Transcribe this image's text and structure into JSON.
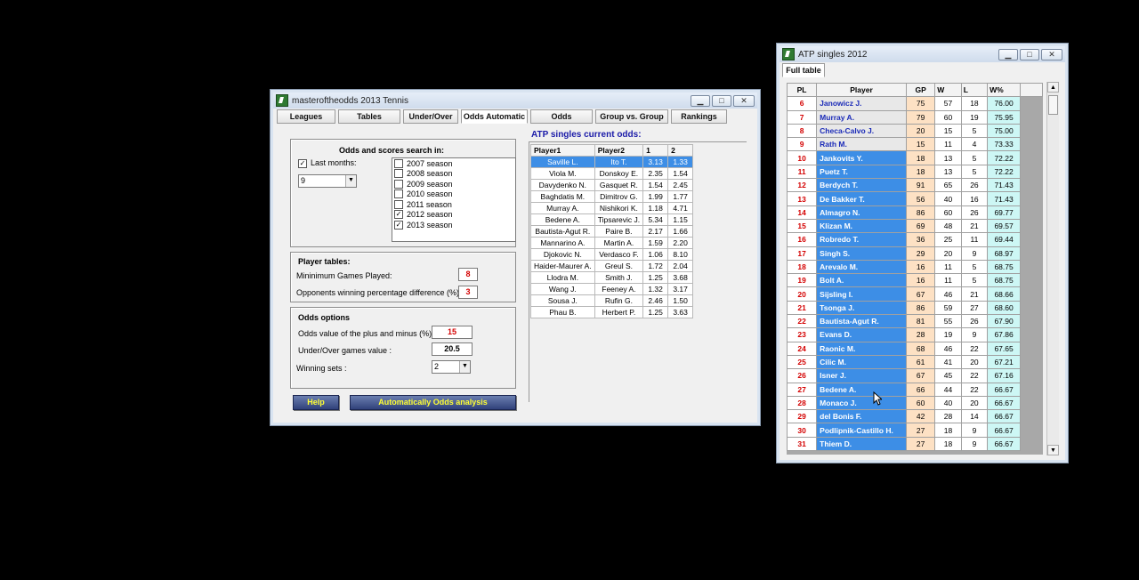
{
  "main_window": {
    "title": "masteroftheodds 2013 Tennis",
    "tabs": [
      "Leagues",
      "Tables",
      "Under/Over",
      "Odds Automatic",
      "Odds",
      "Group vs. Group",
      "Rankings"
    ],
    "search": {
      "title": "Odds and scores search in:",
      "last_months_label": "Last months:",
      "last_months_value": "9",
      "seasons": [
        {
          "label": "2007 season",
          "checked": false
        },
        {
          "label": "2008 season",
          "checked": false
        },
        {
          "label": "2009 season",
          "checked": false
        },
        {
          "label": "2010 season",
          "checked": false
        },
        {
          "label": "2011 season",
          "checked": false
        },
        {
          "label": "2012 season",
          "checked": true
        },
        {
          "label": "2013 season",
          "checked": true
        }
      ]
    },
    "player_tables": {
      "title": "Player tables:",
      "min_games_label": "Mininimum Games Played:",
      "min_games_value": "8",
      "opp_pct_label": "Opponents winning percentage difference (%):",
      "opp_pct_value": "3"
    },
    "odds_options": {
      "title": "Odds options",
      "plus_minus_label": "Odds value of the plus and minus (%):",
      "plus_minus_value": "15",
      "under_over_label": "Under/Over games value :",
      "under_over_value": "20.5",
      "winning_sets_label": "Winning sets :",
      "winning_sets_value": "2"
    },
    "help_button": "Help",
    "analysis_button": "Automatically Odds analysis",
    "odds_panel": {
      "title": "ATP singles current odds:",
      "headers": [
        "Player1",
        "Player2",
        "1",
        "2"
      ],
      "rows": [
        [
          "Saville L.",
          "Ito T.",
          "3.13",
          "1.33"
        ],
        [
          "Viola M.",
          "Donskoy E.",
          "2.35",
          "1.54"
        ],
        [
          "Davydenko N.",
          "Gasquet R.",
          "1.54",
          "2.45"
        ],
        [
          "Baghdatis M.",
          "Dimitrov G.",
          "1.99",
          "1.77"
        ],
        [
          "Murray A.",
          "Nishikori K.",
          "1.18",
          "4.71"
        ],
        [
          "Bedene A.",
          "Tipsarevic J.",
          "5.34",
          "1.15"
        ],
        [
          "Bautista-Agut R.",
          "Paire B.",
          "2.17",
          "1.66"
        ],
        [
          "Mannarino A.",
          "Martin A.",
          "1.59",
          "2.20"
        ],
        [
          "Djokovic N.",
          "Verdasco F.",
          "1.06",
          "8.10"
        ],
        [
          "Haider-Maurer A.",
          "Greul S.",
          "1.72",
          "2.04"
        ],
        [
          "Llodra M.",
          "Smith J.",
          "1.25",
          "3.68"
        ],
        [
          "Wang J.",
          "Feeney A.",
          "1.32",
          "3.17"
        ],
        [
          "Sousa J.",
          "Rufin G.",
          "2.46",
          "1.50"
        ],
        [
          "Phau B.",
          "Herbert P.",
          "1.25",
          "3.63"
        ]
      ]
    }
  },
  "rank_window": {
    "title": "ATP singles 2012",
    "tab": "Full table",
    "headers": [
      "PL",
      "Player",
      "GP",
      "W",
      "L",
      "W%"
    ],
    "rows": [
      [
        "6",
        "Janowicz J.",
        "75",
        "57",
        "18",
        "76.00"
      ],
      [
        "7",
        "Murray A.",
        "79",
        "60",
        "19",
        "75.95"
      ],
      [
        "8",
        "Checa-Calvo J.",
        "20",
        "15",
        "5",
        "75.00"
      ],
      [
        "9",
        "Rath M.",
        "15",
        "11",
        "4",
        "73.33"
      ],
      [
        "10",
        "Jankovits Y.",
        "18",
        "13",
        "5",
        "72.22"
      ],
      [
        "11",
        "Puetz T.",
        "18",
        "13",
        "5",
        "72.22"
      ],
      [
        "12",
        "Berdych T.",
        "91",
        "65",
        "26",
        "71.43"
      ],
      [
        "13",
        "De Bakker T.",
        "56",
        "40",
        "16",
        "71.43"
      ],
      [
        "14",
        "Almagro N.",
        "86",
        "60",
        "26",
        "69.77"
      ],
      [
        "15",
        "Klizan M.",
        "69",
        "48",
        "21",
        "69.57"
      ],
      [
        "16",
        "Robredo T.",
        "36",
        "25",
        "11",
        "69.44"
      ],
      [
        "17",
        "Singh S.",
        "29",
        "20",
        "9",
        "68.97"
      ],
      [
        "18",
        "Arevalo M.",
        "16",
        "11",
        "5",
        "68.75"
      ],
      [
        "19",
        "Bolt A.",
        "16",
        "11",
        "5",
        "68.75"
      ],
      [
        "20",
        "Sijsling I.",
        "67",
        "46",
        "21",
        "68.66"
      ],
      [
        "21",
        "Tsonga J.",
        "86",
        "59",
        "27",
        "68.60"
      ],
      [
        "22",
        "Bautista-Agut R.",
        "81",
        "55",
        "26",
        "67.90"
      ],
      [
        "23",
        "Evans D.",
        "28",
        "19",
        "9",
        "67.86"
      ],
      [
        "24",
        "Raonic M.",
        "68",
        "46",
        "22",
        "67.65"
      ],
      [
        "25",
        "Cilic M.",
        "61",
        "41",
        "20",
        "67.21"
      ],
      [
        "26",
        "Isner J.",
        "67",
        "45",
        "22",
        "67.16"
      ],
      [
        "27",
        "Bedene A.",
        "66",
        "44",
        "22",
        "66.67"
      ],
      [
        "28",
        "Monaco J.",
        "60",
        "40",
        "20",
        "66.67"
      ],
      [
        "29",
        "del Bonis F.",
        "42",
        "28",
        "14",
        "66.67"
      ],
      [
        "30",
        "Podlipnik-Castillo H.",
        "27",
        "18",
        "9",
        "66.67"
      ],
      [
        "31",
        "Thiem D.",
        "27",
        "18",
        "9",
        "66.67"
      ]
    ]
  },
  "colors": {
    "selection_blue": "#3d8ee6",
    "gp_column": "#fde1c4",
    "wp_column": "#cdf7f5",
    "player_name_blue": "#1a2ab8",
    "rank_red": "#d40000",
    "odds_title_blue": "#1a1aa8"
  }
}
